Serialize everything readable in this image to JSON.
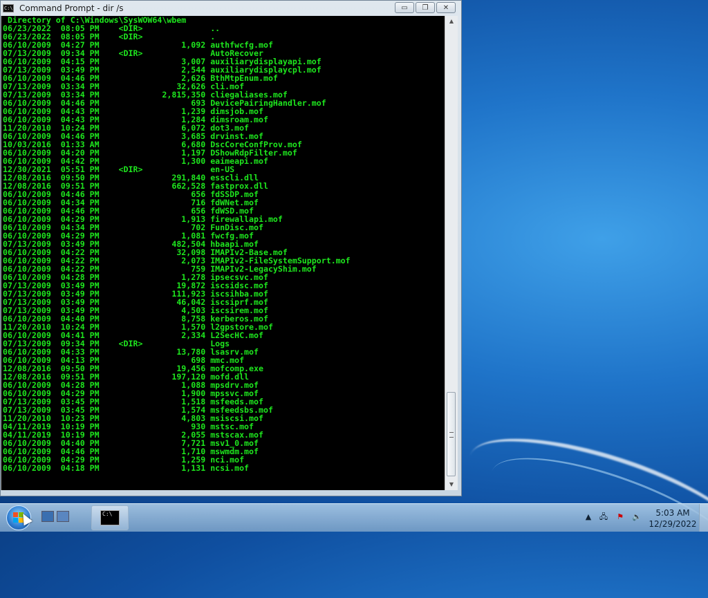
{
  "window": {
    "title": "Command Prompt - dir  /s",
    "icon_text": "C:\\",
    "buttons": {
      "minimize": "▭",
      "maximize": "❐",
      "close": "✕"
    }
  },
  "console": {
    "directory_line": " Directory of C:\\Windows\\SysWOW64\\wbem",
    "entries": [
      [
        "06/23/2022",
        "08:05 PM",
        "<DIR>",
        "",
        ".."
      ],
      [
        "06/23/2022",
        "08:05 PM",
        "<DIR>",
        "",
        "."
      ],
      [
        "06/10/2009",
        "04:27 PM",
        "",
        "1,092",
        "authfwcfg.mof"
      ],
      [
        "07/13/2009",
        "09:34 PM",
        "<DIR>",
        "",
        "AutoRecover"
      ],
      [
        "06/10/2009",
        "04:15 PM",
        "",
        "3,007",
        "auxiliarydisplayapi.mof"
      ],
      [
        "07/13/2009",
        "03:49 PM",
        "",
        "2,544",
        "auxiliarydisplaycpl.mof"
      ],
      [
        "06/10/2009",
        "04:46 PM",
        "",
        "2,626",
        "BthMtpEnum.mof"
      ],
      [
        "07/13/2009",
        "03:34 PM",
        "",
        "32,626",
        "cli.mof"
      ],
      [
        "07/13/2009",
        "03:34 PM",
        "",
        "2,815,350",
        "cliegaliases.mof"
      ],
      [
        "06/10/2009",
        "04:46 PM",
        "",
        "693",
        "DevicePairingHandler.mof"
      ],
      [
        "06/10/2009",
        "04:43 PM",
        "",
        "1,239",
        "dimsjob.mof"
      ],
      [
        "06/10/2009",
        "04:43 PM",
        "",
        "1,284",
        "dimsroam.mof"
      ],
      [
        "11/20/2010",
        "10:24 PM",
        "",
        "6,072",
        "dot3.mof"
      ],
      [
        "06/10/2009",
        "04:46 PM",
        "",
        "3,685",
        "drvinst.mof"
      ],
      [
        "10/03/2016",
        "01:33 AM",
        "",
        "6,680",
        "DscCoreConfProv.mof"
      ],
      [
        "06/10/2009",
        "04:20 PM",
        "",
        "1,197",
        "DShowRdpFilter.mof"
      ],
      [
        "06/10/2009",
        "04:42 PM",
        "",
        "1,300",
        "eaimeapi.mof"
      ],
      [
        "12/30/2021",
        "05:51 PM",
        "<DIR>",
        "",
        "en-US"
      ],
      [
        "12/08/2016",
        "09:50 PM",
        "",
        "291,840",
        "esscli.dll"
      ],
      [
        "12/08/2016",
        "09:51 PM",
        "",
        "662,528",
        "fastprox.dll"
      ],
      [
        "06/10/2009",
        "04:46 PM",
        "",
        "656",
        "fdSSDP.mof"
      ],
      [
        "06/10/2009",
        "04:34 PM",
        "",
        "716",
        "fdWNet.mof"
      ],
      [
        "06/10/2009",
        "04:46 PM",
        "",
        "656",
        "fdWSD.mof"
      ],
      [
        "06/10/2009",
        "04:29 PM",
        "",
        "1,913",
        "firewallapi.mof"
      ],
      [
        "06/10/2009",
        "04:34 PM",
        "",
        "702",
        "FunDisc.mof"
      ],
      [
        "06/10/2009",
        "04:29 PM",
        "",
        "1,081",
        "fwcfg.mof"
      ],
      [
        "07/13/2009",
        "03:49 PM",
        "",
        "482,504",
        "hbaapi.mof"
      ],
      [
        "06/10/2009",
        "04:22 PM",
        "",
        "32,098",
        "IMAPIv2-Base.mof"
      ],
      [
        "06/10/2009",
        "04:22 PM",
        "",
        "2,073",
        "IMAPIv2-FileSystemSupport.mof"
      ],
      [
        "06/10/2009",
        "04:22 PM",
        "",
        "759",
        "IMAPIv2-LegacyShim.mof"
      ],
      [
        "06/10/2009",
        "04:28 PM",
        "",
        "1,278",
        "ipsecsvc.mof"
      ],
      [
        "07/13/2009",
        "03:49 PM",
        "",
        "19,872",
        "iscsidsc.mof"
      ],
      [
        "07/13/2009",
        "03:49 PM",
        "",
        "111,923",
        "iscsihba.mof"
      ],
      [
        "07/13/2009",
        "03:49 PM",
        "",
        "46,042",
        "iscsiprf.mof"
      ],
      [
        "07/13/2009",
        "03:49 PM",
        "",
        "4,503",
        "iscsirem.mof"
      ],
      [
        "06/10/2009",
        "04:40 PM",
        "",
        "8,758",
        "kerberos.mof"
      ],
      [
        "11/20/2010",
        "10:24 PM",
        "",
        "1,570",
        "l2gpstore.mof"
      ],
      [
        "06/10/2009",
        "04:41 PM",
        "",
        "2,334",
        "L2SecHC.mof"
      ],
      [
        "07/13/2009",
        "09:34 PM",
        "<DIR>",
        "",
        "Logs"
      ],
      [
        "06/10/2009",
        "04:33 PM",
        "",
        "13,780",
        "lsasrv.mof"
      ],
      [
        "06/10/2009",
        "04:13 PM",
        "",
        "698",
        "mmc.mof"
      ],
      [
        "12/08/2016",
        "09:50 PM",
        "",
        "19,456",
        "mofcomp.exe"
      ],
      [
        "12/08/2016",
        "09:51 PM",
        "",
        "197,120",
        "mofd.dll"
      ],
      [
        "06/10/2009",
        "04:28 PM",
        "",
        "1,088",
        "mpsdrv.mof"
      ],
      [
        "06/10/2009",
        "04:29 PM",
        "",
        "1,900",
        "mpssvc.mof"
      ],
      [
        "07/13/2009",
        "03:45 PM",
        "",
        "1,518",
        "msfeeds.mof"
      ],
      [
        "07/13/2009",
        "03:45 PM",
        "",
        "1,574",
        "msfeedsbs.mof"
      ],
      [
        "11/20/2010",
        "10:23 PM",
        "",
        "4,803",
        "msiscsi.mof"
      ],
      [
        "04/11/2019",
        "10:19 PM",
        "",
        "930",
        "mstsc.mof"
      ],
      [
        "04/11/2019",
        "10:19 PM",
        "",
        "2,055",
        "mstscax.mof"
      ],
      [
        "06/10/2009",
        "04:40 PM",
        "",
        "7,721",
        "msv1_0.mof"
      ],
      [
        "06/10/2009",
        "04:46 PM",
        "",
        "1,710",
        "mswmdm.mof"
      ],
      [
        "06/10/2009",
        "04:29 PM",
        "",
        "1,259",
        "nci.mof"
      ],
      [
        "06/10/2009",
        "04:18 PM",
        "",
        "1,131",
        "ncsi.mof"
      ]
    ]
  },
  "taskbar": {
    "task_item_icon_text": "C:\\",
    "clock_time": "5:03 AM",
    "clock_date": "12/29/2022",
    "tray_icons": [
      "show-hidden-icons",
      "network-icon",
      "action-center-icon",
      "volume-icon"
    ]
  },
  "colors": {
    "console_text": "#1ee61e",
    "console_bg": "#000000"
  }
}
